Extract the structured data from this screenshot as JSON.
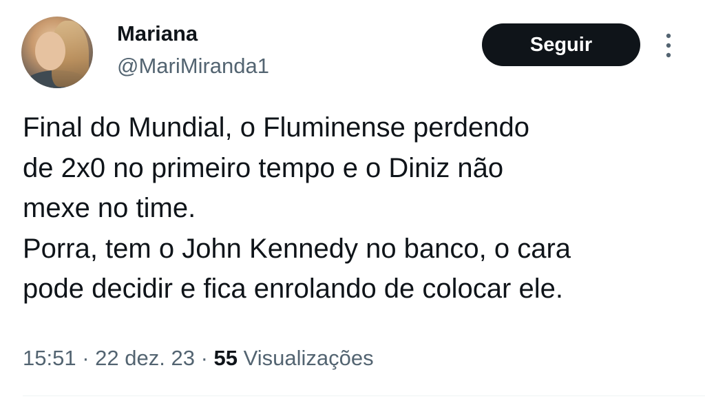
{
  "author": {
    "display_name": "Mariana",
    "handle": "@MariMiranda1"
  },
  "actions": {
    "follow_label": "Seguir",
    "more_icon": "more-vertical-icon"
  },
  "tweet": {
    "text_lines": [
      "Final do Mundial, o Fluminense perdendo",
      "de 2x0 no primeiro tempo e o Diniz não",
      "mexe no time.",
      "Porra, tem o John Kennedy no banco, o cara",
      "pode decidir e fica enrolando de colocar ele."
    ],
    "time": "15:51",
    "separator": "·",
    "date": "22 dez. 23",
    "views_count": "55",
    "views_label": "Visualizações"
  },
  "colors": {
    "text_primary": "#0f1419",
    "text_secondary": "#536471",
    "button_bg": "#0f1419",
    "button_text": "#ffffff",
    "divider": "#eff3f4"
  }
}
